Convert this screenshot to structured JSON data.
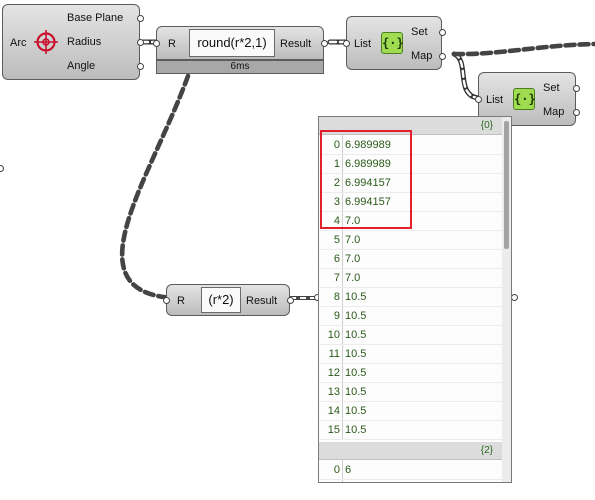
{
  "arc_component": {
    "input": "Arc",
    "outputs": [
      "Base Plane",
      "Radius",
      "Angle"
    ],
    "icon": "arc-target-icon",
    "icon_color": "#c8102e"
  },
  "round_component": {
    "input": "R",
    "expression": "round(r*2,1)",
    "output": "Result",
    "timer": "6ms"
  },
  "expr2_component": {
    "input": "R",
    "expression": "(r*2)",
    "output": "Result"
  },
  "setmap_top": {
    "input": "List",
    "outputs": [
      "Set",
      "Map"
    ],
    "icon_glyph": "{·}"
  },
  "setmap_right": {
    "input": "List",
    "outputs": [
      "Set",
      "Map"
    ],
    "icon_glyph": "{·}"
  },
  "panel": {
    "branches": [
      {
        "path": "{0}",
        "items": [
          {
            "index": "0",
            "value": "6.989989"
          },
          {
            "index": "1",
            "value": "6.989989"
          },
          {
            "index": "2",
            "value": "6.994157"
          },
          {
            "index": "3",
            "value": "6.994157"
          },
          {
            "index": "4",
            "value": "7.0"
          },
          {
            "index": "5",
            "value": "7.0"
          },
          {
            "index": "6",
            "value": "7.0"
          },
          {
            "index": "7",
            "value": "7.0"
          },
          {
            "index": "8",
            "value": "10.5"
          },
          {
            "index": "9",
            "value": "10.5"
          },
          {
            "index": "10",
            "value": "10.5"
          },
          {
            "index": "11",
            "value": "10.5"
          },
          {
            "index": "12",
            "value": "10.5"
          },
          {
            "index": "13",
            "value": "10.5"
          },
          {
            "index": "14",
            "value": "10.5"
          },
          {
            "index": "15",
            "value": "10.5"
          }
        ]
      },
      {
        "path": "{2}",
        "items": [
          {
            "index": "0",
            "value": "6"
          }
        ]
      }
    ],
    "highlight_color": "#e0202a"
  }
}
